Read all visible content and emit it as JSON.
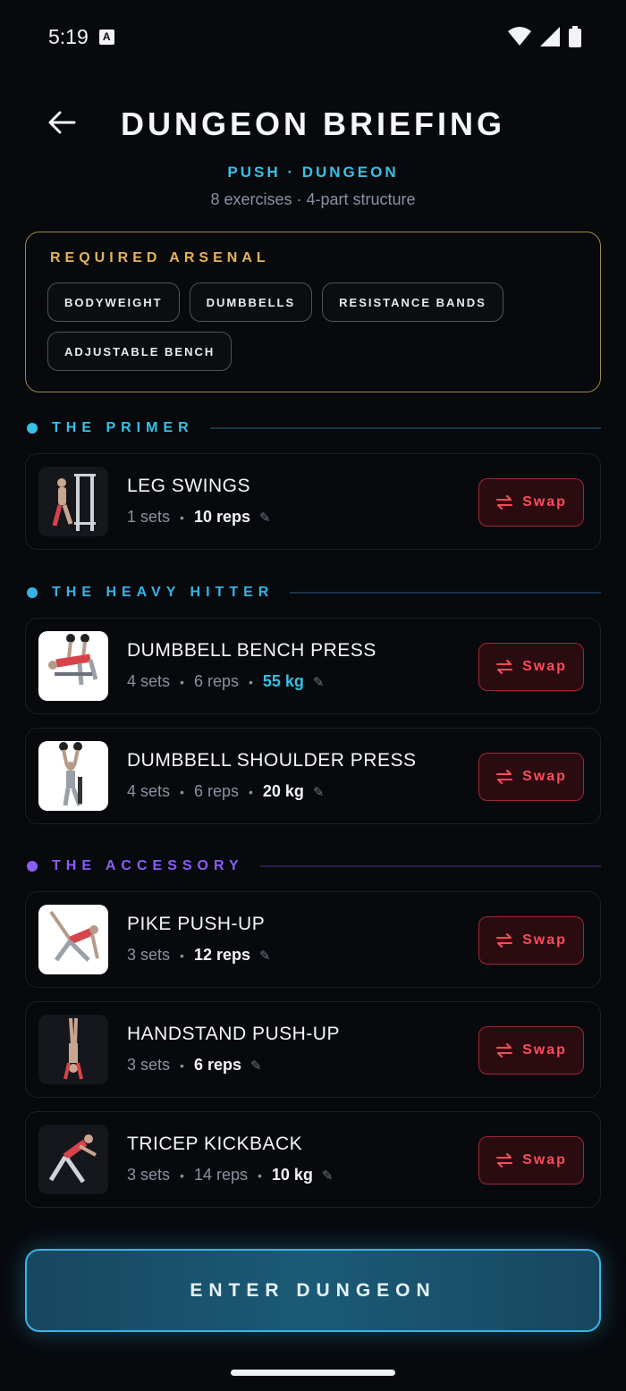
{
  "status_bar": {
    "time": "5:19",
    "badge": "A"
  },
  "header": {
    "title": "DUNGEON BRIEFING"
  },
  "subtitle": "PUSH · DUNGEON",
  "meta": "8 exercises · 4-part structure",
  "arsenal": {
    "title": "REQUIRED ARSENAL",
    "items": [
      "BODYWEIGHT",
      "DUMBBELLS",
      "RESISTANCE BANDS",
      "ADJUSTABLE BENCH"
    ]
  },
  "sections": [
    {
      "label": "THE PRIMER",
      "color": "#35c2e6"
    },
    {
      "label": "THE HEAVY HITTER",
      "color": "#35b4e6"
    },
    {
      "label": "THE ACCESSORY",
      "color": "#8b5cf6"
    }
  ],
  "exercises": [
    {
      "name": "LEG SWINGS",
      "sets": "1 sets",
      "reps": "10 reps",
      "weight": ""
    },
    {
      "name": "DUMBBELL BENCH PRESS",
      "sets": "4 sets",
      "reps": "6 reps",
      "weight": "55 kg"
    },
    {
      "name": "DUMBBELL SHOULDER PRESS",
      "sets": "4 sets",
      "reps": "6 reps",
      "weight": "20 kg"
    },
    {
      "name": "PIKE PUSH-UP",
      "sets": "3 sets",
      "reps": "12 reps",
      "weight": ""
    },
    {
      "name": "HANDSTAND PUSH-UP",
      "sets": "3 sets",
      "reps": "6 reps",
      "weight": ""
    },
    {
      "name": "TRICEP KICKBACK",
      "sets": "3 sets",
      "reps": "14 reps",
      "weight": "10 kg"
    }
  ],
  "swap_label": "Swap",
  "enter_label": "ENTER DUNGEON",
  "colors": {
    "cyan": "#35c2e6",
    "gold": "#e3b45b",
    "red": "#ff4b5c",
    "purple": "#8b5cf6"
  }
}
